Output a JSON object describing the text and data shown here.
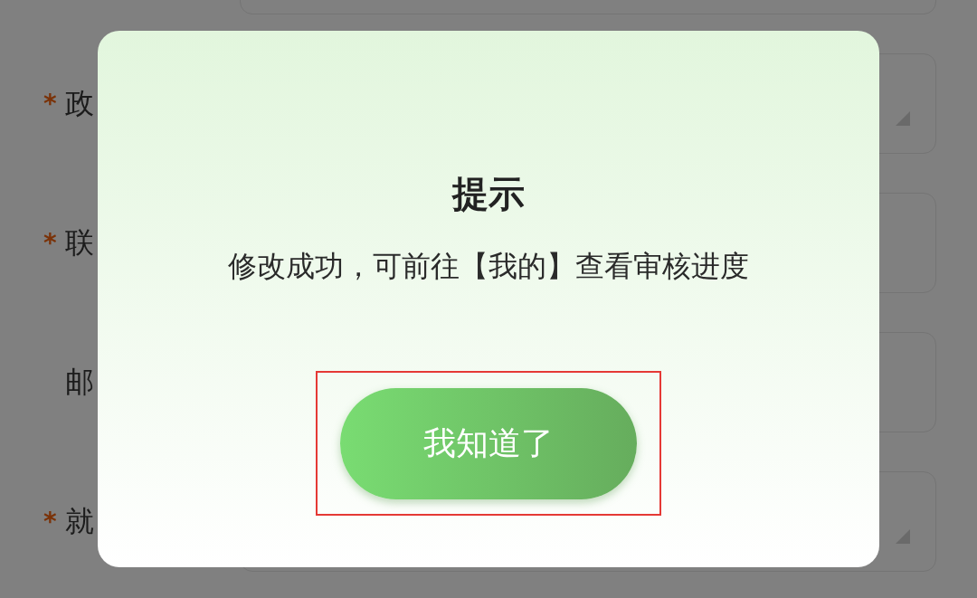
{
  "form": {
    "rows": [
      {
        "kind": "text"
      },
      {
        "marker": "*",
        "label": "政",
        "kind": "select"
      },
      {
        "marker": "*",
        "label": "联",
        "kind": "text"
      },
      {
        "label": "邮",
        "kind": "text"
      },
      {
        "marker": "*",
        "label": "就",
        "kind": "select"
      }
    ]
  },
  "dialog": {
    "title": "提示",
    "message": "修改成功，可前往【我的】查看审核进度",
    "button": "我知道了",
    "button_highlighted": true
  }
}
